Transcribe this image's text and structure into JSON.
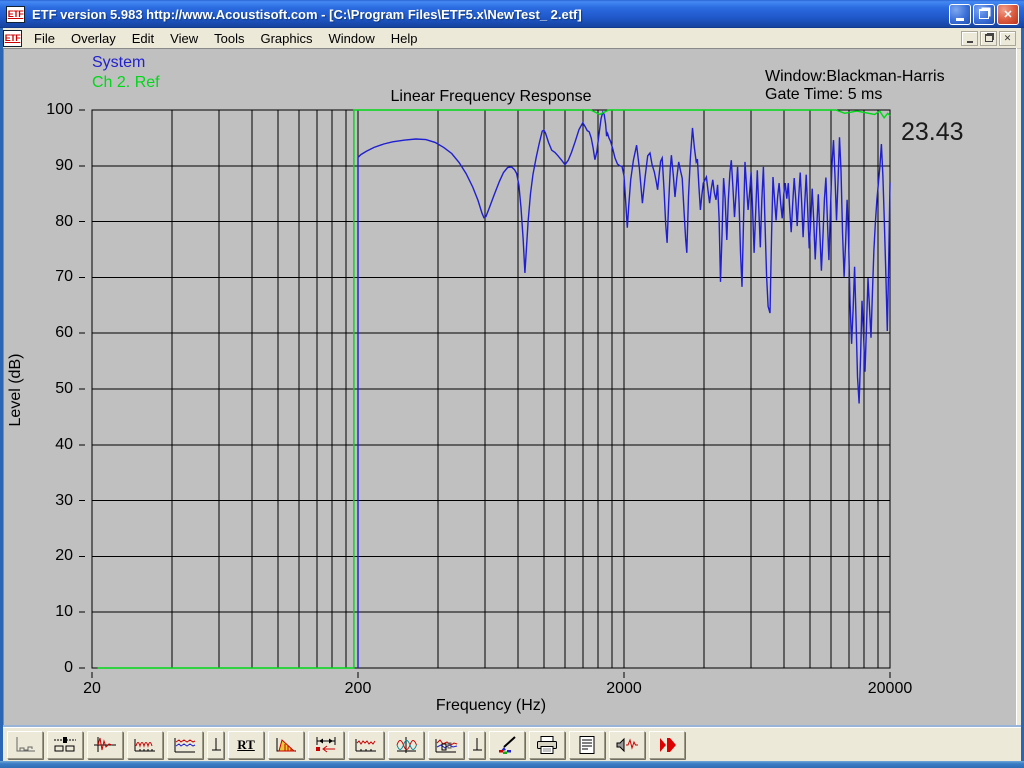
{
  "window": {
    "title": "ETF version 5.983 http://www.Acoustisoft.com - [C:\\Program Files\\ETF5.x\\NewTest_ 2.etf]",
    "app_icon_text": "ETF",
    "controls": [
      "minimize",
      "restore",
      "close"
    ]
  },
  "menu": {
    "items": [
      "File",
      "Overlay",
      "Edit",
      "View",
      "Tools",
      "Graphics",
      "Window",
      "Help"
    ]
  },
  "annotations": {
    "window_function": "Window:Blackman-Harris",
    "gate_time": "Gate Time: 5 ms",
    "cursor_value": "23.43"
  },
  "legend": [
    {
      "label": "System",
      "color": "#2222cc"
    },
    {
      "label": "Ch 2. Ref",
      "color": "#00d818"
    }
  ],
  "toolbar": {
    "rt_label": "RT",
    "buttons": [
      {
        "name": "time-display",
        "icon": "axis-steps"
      },
      {
        "name": "control-panels",
        "icon": "panels"
      },
      {
        "name": "impulse-response",
        "icon": "impulse"
      },
      {
        "name": "frequency-response",
        "icon": "freq-response"
      },
      {
        "name": "waterfall",
        "icon": "waterfall"
      },
      {
        "name": "mini-axis-1",
        "icon": "mini-axis",
        "narrow": true
      },
      {
        "name": "reverb-time",
        "label": "RT"
      },
      {
        "name": "energy-decay",
        "icon": "decay"
      },
      {
        "name": "gate-settings",
        "icon": "gate"
      },
      {
        "name": "smoothed-response",
        "icon": "zigzag"
      },
      {
        "name": "phase-response",
        "icon": "sines"
      },
      {
        "name": "overlay-curves",
        "icon": "multi-curves"
      },
      {
        "name": "mini-axis-2",
        "icon": "mini-axis",
        "narrow": true
      },
      {
        "name": "color-settings",
        "icon": "brush"
      },
      {
        "name": "print",
        "icon": "printer"
      },
      {
        "name": "notes",
        "icon": "document"
      },
      {
        "name": "measure",
        "icon": "speaker-wave"
      },
      {
        "name": "run",
        "icon": "play"
      }
    ]
  },
  "chart_data": {
    "type": "line",
    "title": "Linear Frequency Response",
    "xlabel": "Frequency (Hz)",
    "ylabel": "Level (dB)",
    "x_scale": "log",
    "xlim": [
      20,
      20000
    ],
    "ylim": [
      0,
      100
    ],
    "x_major_ticks": [
      20,
      200,
      2000,
      20000
    ],
    "x_minor_ticks": [
      40,
      60,
      80,
      100,
      120,
      140,
      160,
      180,
      400,
      600,
      800,
      1000,
      1200,
      1400,
      1600,
      1800,
      4000,
      6000,
      8000,
      10000,
      12000,
      14000,
      16000,
      18000
    ],
    "y_ticks": [
      0,
      10,
      20,
      30,
      40,
      50,
      60,
      70,
      80,
      90,
      100
    ],
    "grid": true,
    "legend_position": "top-left",
    "series": [
      {
        "name": "Ch 2. Ref",
        "color": "#00d818",
        "points": [
          [
            21,
            0
          ],
          [
            193,
            0
          ],
          [
            193,
            100
          ],
          [
            1500,
            100
          ],
          [
            1620,
            99.2
          ],
          [
            1750,
            100
          ],
          [
            12500,
            100
          ],
          [
            13500,
            99.4
          ],
          [
            15000,
            99.8
          ],
          [
            17500,
            99.2
          ],
          [
            18300,
            99.8
          ],
          [
            19000,
            98.6
          ],
          [
            19600,
            99.4
          ],
          [
            20000,
            99.0
          ]
        ]
      },
      {
        "name": "System",
        "color": "#1f1fd0",
        "points": [
          [
            200,
            0
          ],
          [
            200,
            91.5
          ],
          [
            205,
            92.0
          ],
          [
            215,
            92.6
          ],
          [
            230,
            93.3
          ],
          [
            250,
            93.9
          ],
          [
            270,
            94.3
          ],
          [
            300,
            94.6
          ],
          [
            330,
            94.8
          ],
          [
            360,
            94.7
          ],
          [
            390,
            94.2
          ],
          [
            420,
            93.3
          ],
          [
            450,
            92.2
          ],
          [
            480,
            90.6
          ],
          [
            510,
            88.6
          ],
          [
            540,
            86.2
          ],
          [
            565,
            83.8
          ],
          [
            585,
            81.5
          ],
          [
            595,
            80.7
          ],
          [
            605,
            80.9
          ],
          [
            625,
            82.6
          ],
          [
            650,
            84.8
          ],
          [
            680,
            87.2
          ],
          [
            705,
            88.8
          ],
          [
            730,
            89.7
          ],
          [
            755,
            89.8
          ],
          [
            775,
            89.3
          ],
          [
            790,
            88.6
          ],
          [
            805,
            86.5
          ],
          [
            820,
            82.5
          ],
          [
            835,
            77.0
          ],
          [
            848,
            70.8
          ],
          [
            858,
            74.5
          ],
          [
            872,
            80.0
          ],
          [
            890,
            85.0
          ],
          [
            910,
            88.5
          ],
          [
            935,
            91.5
          ],
          [
            960,
            94.0
          ],
          [
            985,
            96.2
          ],
          [
            1000,
            96.4
          ],
          [
            1015,
            95.8
          ],
          [
            1040,
            94.2
          ],
          [
            1070,
            92.8
          ],
          [
            1100,
            92.4
          ],
          [
            1130,
            91.8
          ],
          [
            1165,
            91.0
          ],
          [
            1200,
            90.2
          ],
          [
            1235,
            91.0
          ],
          [
            1270,
            92.4
          ],
          [
            1310,
            94.3
          ],
          [
            1355,
            96.5
          ],
          [
            1400,
            97.7
          ],
          [
            1430,
            97.0
          ],
          [
            1455,
            96.3
          ],
          [
            1480,
            96.1
          ],
          [
            1505,
            95.0
          ],
          [
            1530,
            93.2
          ],
          [
            1555,
            91.1
          ],
          [
            1580,
            92.5
          ],
          [
            1610,
            95.5
          ],
          [
            1640,
            98.5
          ],
          [
            1665,
            99.6
          ],
          [
            1685,
            99.2
          ],
          [
            1705,
            97.5
          ],
          [
            1720,
            95.3
          ],
          [
            1735,
            95.8
          ],
          [
            1755,
            95.0
          ],
          [
            1780,
            94.4
          ],
          [
            1815,
            93.0
          ],
          [
            1850,
            91.4
          ],
          [
            1890,
            90.3
          ],
          [
            1930,
            90.0
          ],
          [
            1965,
            89.9
          ],
          [
            2000,
            88.2
          ],
          [
            2030,
            83.5
          ],
          [
            2058,
            78.9
          ],
          [
            2085,
            83.0
          ],
          [
            2120,
            87.5
          ],
          [
            2170,
            91.0
          ],
          [
            2230,
            93.7
          ],
          [
            2285,
            89.5
          ],
          [
            2345,
            83.3
          ],
          [
            2400,
            88.0
          ],
          [
            2455,
            91.8
          ],
          [
            2505,
            92.3
          ],
          [
            2550,
            90.2
          ],
          [
            2600,
            88.9
          ],
          [
            2645,
            87.1
          ],
          [
            2675,
            85.7
          ],
          [
            2705,
            88.0
          ],
          [
            2745,
            90.8
          ],
          [
            2785,
            91.4
          ],
          [
            2830,
            85.5
          ],
          [
            2870,
            79.5
          ],
          [
            2905,
            76.2
          ],
          [
            2945,
            83.5
          ],
          [
            2985,
            89.5
          ],
          [
            3015,
            91.9
          ],
          [
            3065,
            88.3
          ],
          [
            3110,
            84.4
          ],
          [
            3160,
            87.8
          ],
          [
            3210,
            90.7
          ],
          [
            3260,
            89.2
          ],
          [
            3310,
            87.8
          ],
          [
            3360,
            82.3
          ],
          [
            3410,
            77.0
          ],
          [
            3445,
            74.4
          ],
          [
            3495,
            84.5
          ],
          [
            3555,
            91.5
          ],
          [
            3620,
            96.8
          ],
          [
            3680,
            93.2
          ],
          [
            3735,
            90.7
          ],
          [
            3775,
            91.2
          ],
          [
            3825,
            86.3
          ],
          [
            3875,
            82.1
          ],
          [
            3925,
            84.8
          ],
          [
            3975,
            86.9
          ],
          [
            4080,
            88.0
          ],
          [
            4140,
            85.6
          ],
          [
            4195,
            83.3
          ],
          [
            4255,
            85.8
          ],
          [
            4315,
            87.5
          ],
          [
            4375,
            85.1
          ],
          [
            4435,
            83.9
          ],
          [
            4495,
            86.6
          ],
          [
            4555,
            80.5
          ],
          [
            4610,
            69.2
          ],
          [
            4670,
            77.5
          ],
          [
            4735,
            87.8
          ],
          [
            4800,
            84.2
          ],
          [
            4870,
            76.7
          ],
          [
            4935,
            83.8
          ],
          [
            5000,
            88.8
          ],
          [
            5065,
            91.0
          ],
          [
            5135,
            86.2
          ],
          [
            5205,
            80.8
          ],
          [
            5275,
            85.0
          ],
          [
            5345,
            89.8
          ],
          [
            5415,
            83.2
          ],
          [
            5485,
            74.5
          ],
          [
            5555,
            68.3
          ],
          [
            5625,
            79.8
          ],
          [
            5700,
            90.7
          ],
          [
            5780,
            86.1
          ],
          [
            5855,
            82.1
          ],
          [
            5935,
            85.4
          ],
          [
            6010,
            88.9
          ],
          [
            6090,
            82.2
          ],
          [
            6170,
            74.4
          ],
          [
            6255,
            81.8
          ],
          [
            6340,
            89.2
          ],
          [
            6425,
            82.3
          ],
          [
            6510,
            75.4
          ],
          [
            6595,
            83.8
          ],
          [
            6685,
            89.8
          ],
          [
            6775,
            80.3
          ],
          [
            6870,
            70.2
          ],
          [
            6965,
            64.8
          ],
          [
            7080,
            63.6
          ],
          [
            7175,
            77.8
          ],
          [
            7265,
            88.0
          ],
          [
            7360,
            84.1
          ],
          [
            7460,
            80.2
          ],
          [
            7560,
            84.4
          ],
          [
            7660,
            86.9
          ],
          [
            7765,
            83.2
          ],
          [
            7865,
            80.6
          ],
          [
            7970,
            84.8
          ],
          [
            8075,
            86.9
          ],
          [
            8185,
            84.1
          ],
          [
            8290,
            86.9
          ],
          [
            8395,
            82.2
          ],
          [
            8505,
            78.1
          ],
          [
            8615,
            83.2
          ],
          [
            8725,
            87.8
          ],
          [
            8840,
            84.1
          ],
          [
            8955,
            79.2
          ],
          [
            9070,
            84.1
          ],
          [
            9190,
            88.8
          ],
          [
            9310,
            83.2
          ],
          [
            9430,
            77.2
          ],
          [
            9555,
            83.1
          ],
          [
            9680,
            88.4
          ],
          [
            9805,
            82.1
          ],
          [
            9935,
            75.2
          ],
          [
            10070,
            80.1
          ],
          [
            10200,
            85.9
          ],
          [
            10340,
            79.9
          ],
          [
            10470,
            73.2
          ],
          [
            10610,
            79.1
          ],
          [
            10750,
            84.9
          ],
          [
            10890,
            78.1
          ],
          [
            11040,
            71.2
          ],
          [
            11190,
            77.1
          ],
          [
            11330,
            83.9
          ],
          [
            11480,
            87.9
          ],
          [
            11630,
            80.2
          ],
          [
            11790,
            73.1
          ],
          [
            11940,
            81.9
          ],
          [
            12100,
            89.9
          ],
          [
            12260,
            94.6
          ],
          [
            12420,
            88.1
          ],
          [
            12590,
            80.2
          ],
          [
            12750,
            87.1
          ],
          [
            12920,
            95.1
          ],
          [
            13090,
            89.2
          ],
          [
            13260,
            78.2
          ],
          [
            13440,
            70.1
          ],
          [
            13620,
            76.2
          ],
          [
            13790,
            83.9
          ],
          [
            13970,
            77.1
          ],
          [
            14160,
            65.2
          ],
          [
            14340,
            58.1
          ],
          [
            14530,
            64.2
          ],
          [
            14720,
            71.9
          ],
          [
            14910,
            62.1
          ],
          [
            15100,
            52.2
          ],
          [
            15300,
            47.4
          ],
          [
            15500,
            55.9
          ],
          [
            15700,
            65.8
          ],
          [
            15900,
            59.9
          ],
          [
            16110,
            53.1
          ],
          [
            16320,
            61.2
          ],
          [
            16530,
            69.9
          ],
          [
            16740,
            64.9
          ],
          [
            16960,
            59.2
          ],
          [
            17180,
            67.1
          ],
          [
            17400,
            74.9
          ],
          [
            17630,
            79.9
          ],
          [
            17860,
            83.9
          ],
          [
            18090,
            86.9
          ],
          [
            18330,
            89.9
          ],
          [
            18560,
            93.9
          ],
          [
            18800,
            88.1
          ],
          [
            19040,
            80.2
          ],
          [
            19280,
            70.9
          ],
          [
            19530,
            60.4
          ],
          [
            19770,
            72.9
          ],
          [
            20000,
            87.0
          ]
        ]
      }
    ]
  }
}
